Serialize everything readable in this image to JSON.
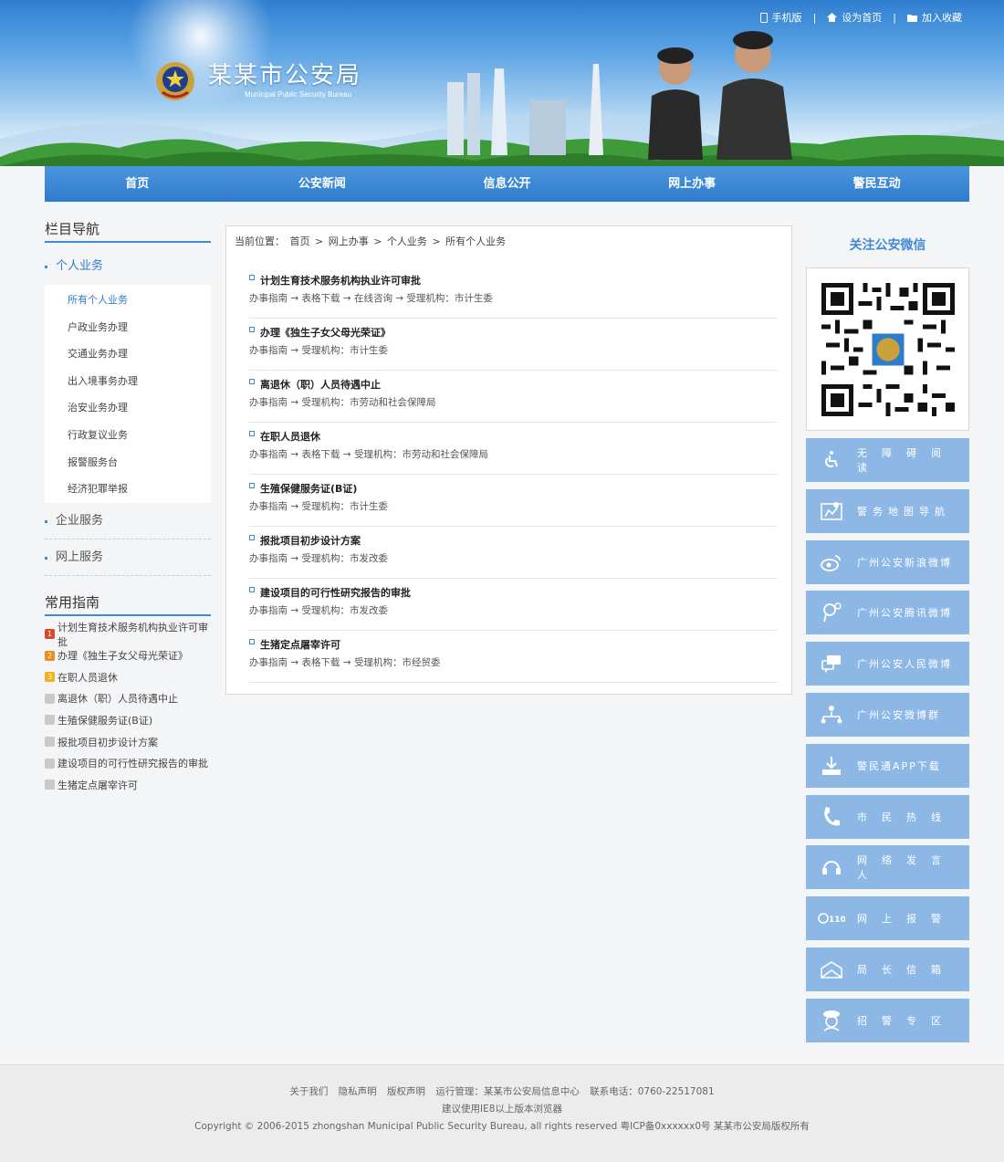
{
  "header": {
    "site_title": "某某市公安局",
    "site_subtitle": "Municipal Public Security Bureau",
    "top_links": [
      "手机版",
      "设为首页",
      "加入收藏"
    ],
    "separator": "|"
  },
  "nav": [
    "首页",
    "公安新闻",
    "信息公开",
    "网上办事",
    "警民互动"
  ],
  "sidebar": {
    "nav_title": "栏目导航",
    "active_category": "个人业务",
    "sub_items": [
      "所有个人业务",
      "户政业务办理",
      "交通业务办理",
      "出入境事务办理",
      "治安业务办理",
      "行政复议业务",
      "报警服务台",
      "经济犯罪举报"
    ],
    "other_categories": [
      "企业服务",
      "网上服务"
    ],
    "guide_title": "常用指南",
    "guide_items": [
      {
        "text": "计划生育技术服务机构执业许可审批",
        "badge": "1"
      },
      {
        "text": "办理《独生子女父母光荣证》",
        "badge": "2"
      },
      {
        "text": "在职人员退休",
        "badge": "3"
      },
      {
        "text": "离退休（职）人员待遇中止",
        "badge": ""
      },
      {
        "text": "生殖保健服务证(B证)",
        "badge": ""
      },
      {
        "text": "报批项目初步设计方案",
        "badge": ""
      },
      {
        "text": "建设项目的可行性研究报告的审批",
        "badge": ""
      },
      {
        "text": "生猪定点屠宰许可",
        "badge": ""
      }
    ]
  },
  "breadcrumb": {
    "prefix": "当前位置：",
    "parts": [
      "首页",
      "网上办事",
      "个人业务",
      "所有个人业务"
    ],
    "sep": ">"
  },
  "entries": [
    {
      "title": "计划生育技术服务机构执业许可审批",
      "meta": "办事指南 → 表格下载 → 在线咨询 → 受理机构：市计生委"
    },
    {
      "title": "办理《独生子女父母光荣证》",
      "meta": "办事指南 → 受理机构：市计生委"
    },
    {
      "title": "离退休（职）人员待遇中止",
      "meta": "办事指南 → 受理机构：市劳动和社会保障局"
    },
    {
      "title": "在职人员退休",
      "meta": "办事指南 → 表格下载 → 受理机构：市劳动和社会保障局"
    },
    {
      "title": "生殖保健服务证(B证)",
      "meta": "办事指南 → 受理机构：市计生委"
    },
    {
      "title": "报批项目初步设计方案",
      "meta": "办事指南 → 受理机构：市发改委"
    },
    {
      "title": "建设项目的可行性研究报告的审批",
      "meta": "办事指南 → 受理机构：市发改委"
    },
    {
      "title": "生猪定点屠宰许可",
      "meta": "办事指南 → 表格下载 → 受理机构：市经贸委"
    }
  ],
  "right": {
    "wechat_title": "关注公安微信",
    "services": [
      {
        "label": "无障碍阅读",
        "icon": "accessibility-icon",
        "spacing": "wide"
      },
      {
        "label": "警务地图导航",
        "icon": "map-icon",
        "spacing": "mid"
      },
      {
        "label": "广州公安新浪微博",
        "icon": "weibo-icon",
        "spacing": "normal"
      },
      {
        "label": "广州公安腾讯微博",
        "icon": "tencent-weibo-icon",
        "spacing": "normal"
      },
      {
        "label": "广州公安人民微博",
        "icon": "chat-icon",
        "spacing": "normal"
      },
      {
        "label": "广州公安微博群",
        "icon": "group-icon",
        "spacing": "normal"
      },
      {
        "label": "警民通APP下载",
        "icon": "download-icon",
        "spacing": "normal"
      },
      {
        "label": "市民热线",
        "icon": "phone-icon",
        "spacing": "wide"
      },
      {
        "label": "网络发言人",
        "icon": "headset-icon",
        "spacing": "wide"
      },
      {
        "label": "网上报警",
        "icon": "alarm-110-icon",
        "spacing": "wide",
        "badge": "110"
      },
      {
        "label": "局长信箱",
        "icon": "mail-icon",
        "spacing": "wide"
      },
      {
        "label": "招警专区",
        "icon": "police-officer-icon",
        "spacing": "wide"
      }
    ]
  },
  "footer": {
    "links": [
      "关于我们",
      "隐私声明",
      "版权声明",
      "运行管理：某某市公安局信息中心",
      "联系电话：0760-22517081"
    ],
    "browser_note": "建议使用IE8以上版本浏览器",
    "copyright": "Copyright © 2006-2015 zhongshan Municipal Public Security Bureau, all rights reserved 粤ICP备0xxxxxx0号 某某市公安局版权所有"
  },
  "colors": {
    "primary": "#3f8ad6",
    "nav": "#2f7ccd",
    "service_tile": "#8db8e6"
  }
}
